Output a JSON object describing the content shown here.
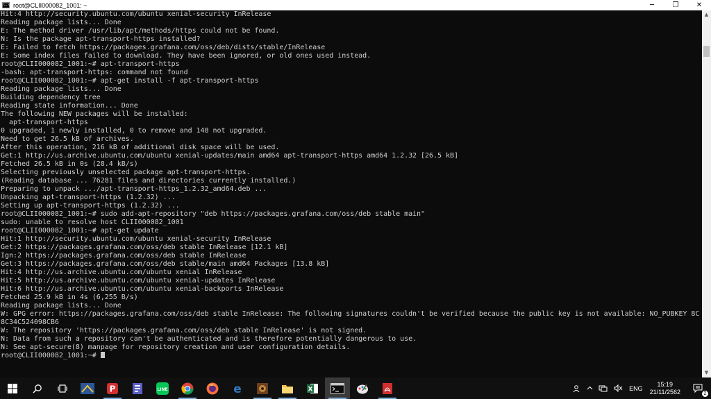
{
  "window": {
    "title": "root@CLII000082_1001: ~",
    "icon_glyph": "C:\\",
    "controls": {
      "minimize": "─",
      "maximize": "❐",
      "close": "✕"
    }
  },
  "terminal": {
    "lines": [
      "Hit:4 http://security.ubuntu.com/ubuntu xenial-security InRelease",
      "Reading package lists... Done",
      "E: The method driver /usr/lib/apt/methods/https could not be found.",
      "N: Is the package apt-transport-https installed?",
      "E: Failed to fetch https://packages.grafana.com/oss/deb/dists/stable/InRelease",
      "E: Some index files failed to download. They have been ignored, or old ones used instead.",
      "root@CLII000082_1001:~# apt-transport-https",
      "-bash: apt-transport-https: command not found",
      "root@CLII000082_1001:~# apt-get install -f apt-transport-https",
      "Reading package lists... Done",
      "Building dependency tree",
      "Reading state information... Done",
      "The following NEW packages will be installed:",
      "  apt-transport-https",
      "0 upgraded, 1 newly installed, 0 to remove and 148 not upgraded.",
      "Need to get 26.5 kB of archives.",
      "After this operation, 216 kB of additional disk space will be used.",
      "Get:1 http://us.archive.ubuntu.com/ubuntu xenial-updates/main amd64 apt-transport-https amd64 1.2.32 [26.5 kB]",
      "Fetched 26.5 kB in 0s (28.4 kB/s)",
      "Selecting previously unselected package apt-transport-https.",
      "(Reading database ... 76281 files and directories currently installed.)",
      "Preparing to unpack .../apt-transport-https_1.2.32_amd64.deb ...",
      "Unpacking apt-transport-https (1.2.32) ...",
      "Setting up apt-transport-https (1.2.32) ...",
      "root@CLII000082_1001:~# sudo add-apt-repository \"deb https://packages.grafana.com/oss/deb stable main\"",
      "sudo: unable to resolve host CLII000082_1001",
      "root@CLII000082_1001:~# apt-get update",
      "Hit:1 http://security.ubuntu.com/ubuntu xenial-security InRelease",
      "Get:2 https://packages.grafana.com/oss/deb stable InRelease [12.1 kB]",
      "Ign:2 https://packages.grafana.com/oss/deb stable InRelease",
      "Get:3 https://packages.grafana.com/oss/deb stable/main amd64 Packages [13.8 kB]",
      "Hit:4 http://us.archive.ubuntu.com/ubuntu xenial InRelease",
      "Hit:5 http://us.archive.ubuntu.com/ubuntu xenial-updates InRelease",
      "Hit:6 http://us.archive.ubuntu.com/ubuntu xenial-backports InRelease",
      "Fetched 25.9 kB in 4s (6,255 B/s)",
      "Reading package lists... Done",
      "W: GPG error: https://packages.grafana.com/oss/deb stable InRelease: The following signatures couldn't be verified because the public key is not available: NO_PUBKEY 8C",
      "8C34C524098CB6",
      "W: The repository 'https://packages.grafana.com/oss/deb stable InRelease' is not signed.",
      "N: Data from such a repository can't be authenticated and is therefore potentially dangerous to use.",
      "N: See apt-secure(8) manpage for repository creation and user configuration details."
    ],
    "prompt": "root@CLII000082_1001:~# "
  },
  "taskbar": {
    "apps": [
      {
        "name": "start-button",
        "icon": "windows-logo-icon",
        "active": false
      },
      {
        "name": "search-button",
        "icon": "search-icon",
        "active": false
      },
      {
        "name": "task-view-button",
        "icon": "task-view-icon",
        "active": false
      },
      {
        "name": "taskbar-app-1",
        "icon": "app-blue-icon",
        "active": false
      },
      {
        "name": "taskbar-app-2",
        "icon": "app-red-p-icon",
        "active": false
      },
      {
        "name": "taskbar-app-3",
        "icon": "app-purple-icon",
        "active": false
      },
      {
        "name": "taskbar-app-line",
        "icon": "line-icon",
        "active": false
      },
      {
        "name": "taskbar-app-chrome",
        "icon": "chrome-icon",
        "active": false
      },
      {
        "name": "taskbar-app-firefox",
        "icon": "firefox-icon",
        "active": false
      },
      {
        "name": "taskbar-app-edge",
        "icon": "edge-icon",
        "active": false
      },
      {
        "name": "taskbar-app-7",
        "icon": "app-brown-icon",
        "active": false
      },
      {
        "name": "taskbar-app-explorer",
        "icon": "folder-icon",
        "active": false
      },
      {
        "name": "taskbar-app-excel",
        "icon": "excel-icon",
        "active": false
      },
      {
        "name": "taskbar-app-terminal",
        "icon": "terminal-icon",
        "active": true
      },
      {
        "name": "taskbar-app-paint",
        "icon": "paint-icon",
        "active": false
      },
      {
        "name": "taskbar-app-pdf",
        "icon": "pdf-icon",
        "active": false
      }
    ],
    "tray": {
      "people_glyph": "ጰ",
      "chevron_glyph": "^",
      "network_glyph": "⌂",
      "volume_glyph": "◁×",
      "language": "ENG",
      "time": "15:19",
      "date": "21/11/2562",
      "notifications_count": "2"
    },
    "colors": {
      "accent": "#7aa7d6",
      "background": "#101010"
    }
  }
}
